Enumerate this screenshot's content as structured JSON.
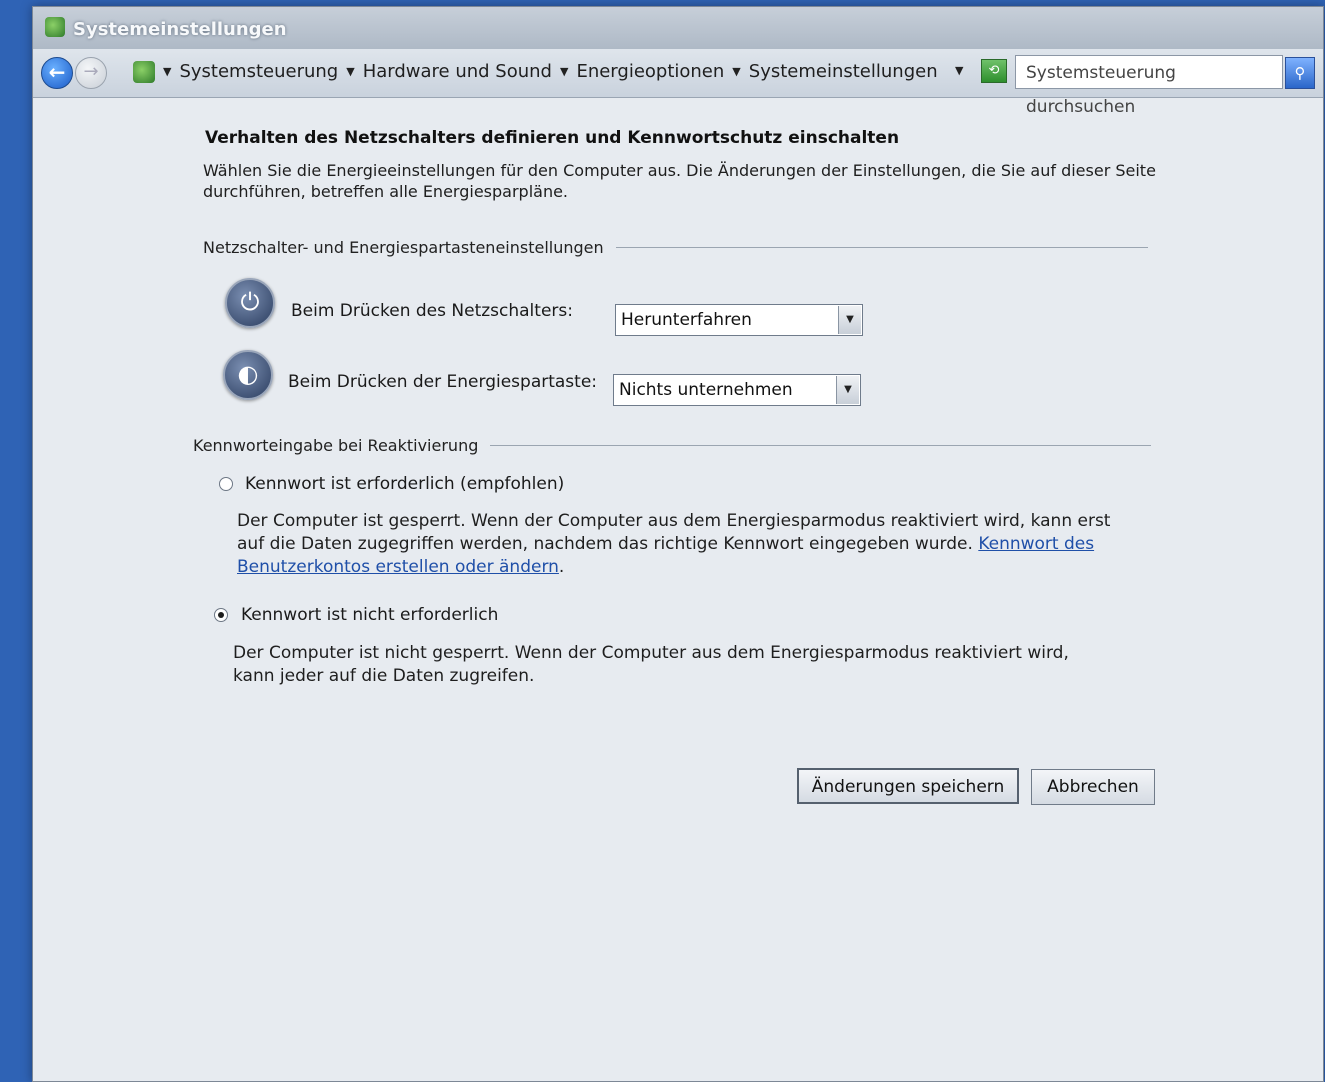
{
  "window": {
    "title": "Systemeinstellungen"
  },
  "window_controls": {
    "minimize": "_",
    "maximize": "□",
    "close": "×"
  },
  "address": {
    "breadcrumbs": [
      "Systemsteuerung",
      "Hardware und Sound",
      "Energieoptionen",
      "Systemeinstellungen"
    ],
    "search_placeholder": "Systemsteuerung durchsuchen"
  },
  "main": {
    "heading": "Verhalten des Netzschalters definieren und Kennwortschutz einschalten",
    "intro": "Wählen Sie die Energieeinstellungen für den Computer aus. Die Änderungen der Einstellungen, die Sie auf dieser Seite durchführen, betreffen alle Energiesparpläne.",
    "power_section": {
      "label": "Netzschalter- und Energiespartasteneinstellungen",
      "power_button_label": "Beim Drücken des Netzschalters:",
      "power_button_value": "Herunterfahren",
      "sleep_button_label": "Beim Drücken der Energiespartaste:",
      "sleep_button_value": "Nichts unternehmen"
    },
    "password_section": {
      "label": "Kennworteingabe bei Reaktivierung",
      "option_required_label": "Kennwort ist erforderlich (empfohlen)",
      "option_required_desc": "Der Computer ist gesperrt. Wenn der Computer aus dem Energiesparmodus reaktiviert wird, kann erst auf die Daten zugegriffen werden, nachdem das richtige Kennwort eingegeben wurde.",
      "option_required_link": "Kennwort des Benutzerkontos erstellen oder ändern",
      "option_not_required_label": "Kennwort ist nicht erforderlich",
      "option_not_required_desc": "Der Computer ist nicht gesperrt. Wenn der Computer aus dem Energiesparmodus reaktiviert wird, kann jeder auf die Daten zugreifen.",
      "selected": "not_required"
    }
  },
  "buttons": {
    "save": "Änderungen speichern",
    "cancel": "Abbrechen"
  }
}
